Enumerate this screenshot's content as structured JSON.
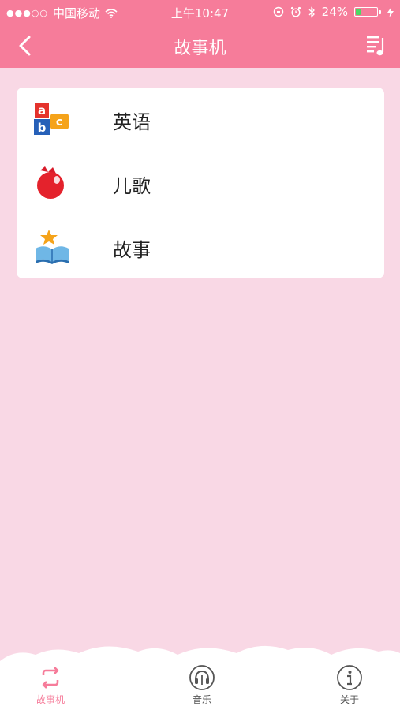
{
  "status_bar": {
    "carrier": "中国移动",
    "time": "上午10:47",
    "battery_percent": "24%",
    "battery_level": 0.24
  },
  "nav": {
    "title": "故事机",
    "back_icon": "chevron-left-icon",
    "right_icon": "music-list-icon"
  },
  "menu": {
    "items": [
      {
        "label": "英语",
        "icon": "abc-blocks-icon"
      },
      {
        "label": "儿歌",
        "icon": "red-cherry-icon"
      },
      {
        "label": "故事",
        "icon": "storybook-icon"
      }
    ]
  },
  "tabs": [
    {
      "label": "故事机",
      "icon": "repeat-icon",
      "active": true
    },
    {
      "label": "音乐",
      "icon": "headphone-icon",
      "active": false
    },
    {
      "label": "关于",
      "icon": "info-icon",
      "active": false
    }
  ],
  "colors": {
    "accent": "#f67c9a",
    "background": "#f9d8e5",
    "tab_inactive": "#555555"
  }
}
